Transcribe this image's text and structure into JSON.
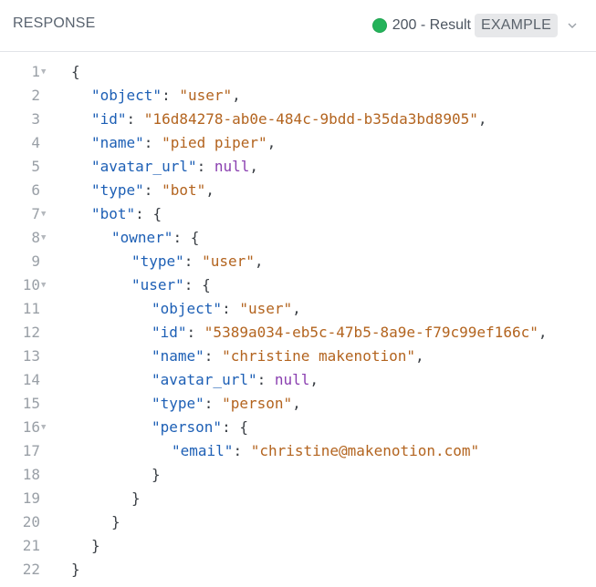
{
  "header": {
    "title": "RESPONSE",
    "status_text": "200 - Result",
    "example_label": "EXAMPLE",
    "status_color": "#24b35a"
  },
  "code": {
    "lines": [
      {
        "num": "1",
        "fold": true,
        "indent": 0,
        "parts": [
          {
            "t": "p",
            "v": "{"
          }
        ]
      },
      {
        "num": "2",
        "fold": false,
        "indent": 1,
        "parts": [
          {
            "t": "k",
            "v": "\"object\""
          },
          {
            "t": "p",
            "v": ": "
          },
          {
            "t": "s",
            "v": "\"user\""
          },
          {
            "t": "p",
            "v": ","
          }
        ]
      },
      {
        "num": "3",
        "fold": false,
        "indent": 1,
        "parts": [
          {
            "t": "k",
            "v": "\"id\""
          },
          {
            "t": "p",
            "v": ": "
          },
          {
            "t": "s",
            "v": "\"16d84278-ab0e-484c-9bdd-b35da3bd8905\""
          },
          {
            "t": "p",
            "v": ","
          }
        ]
      },
      {
        "num": "4",
        "fold": false,
        "indent": 1,
        "parts": [
          {
            "t": "k",
            "v": "\"name\""
          },
          {
            "t": "p",
            "v": ": "
          },
          {
            "t": "s",
            "v": "\"pied piper\""
          },
          {
            "t": "p",
            "v": ","
          }
        ]
      },
      {
        "num": "5",
        "fold": false,
        "indent": 1,
        "parts": [
          {
            "t": "k",
            "v": "\"avatar_url\""
          },
          {
            "t": "p",
            "v": ": "
          },
          {
            "t": "n",
            "v": "null"
          },
          {
            "t": "p",
            "v": ","
          }
        ]
      },
      {
        "num": "6",
        "fold": false,
        "indent": 1,
        "parts": [
          {
            "t": "k",
            "v": "\"type\""
          },
          {
            "t": "p",
            "v": ": "
          },
          {
            "t": "s",
            "v": "\"bot\""
          },
          {
            "t": "p",
            "v": ","
          }
        ]
      },
      {
        "num": "7",
        "fold": true,
        "indent": 1,
        "parts": [
          {
            "t": "k",
            "v": "\"bot\""
          },
          {
            "t": "p",
            "v": ": {"
          }
        ]
      },
      {
        "num": "8",
        "fold": true,
        "indent": 2,
        "parts": [
          {
            "t": "k",
            "v": "\"owner\""
          },
          {
            "t": "p",
            "v": ": {"
          }
        ]
      },
      {
        "num": "9",
        "fold": false,
        "indent": 3,
        "parts": [
          {
            "t": "k",
            "v": "\"type\""
          },
          {
            "t": "p",
            "v": ": "
          },
          {
            "t": "s",
            "v": "\"user\""
          },
          {
            "t": "p",
            "v": ","
          }
        ]
      },
      {
        "num": "10",
        "fold": true,
        "indent": 3,
        "parts": [
          {
            "t": "k",
            "v": "\"user\""
          },
          {
            "t": "p",
            "v": ": {"
          }
        ]
      },
      {
        "num": "11",
        "fold": false,
        "indent": 4,
        "parts": [
          {
            "t": "k",
            "v": "\"object\""
          },
          {
            "t": "p",
            "v": ": "
          },
          {
            "t": "s",
            "v": "\"user\""
          },
          {
            "t": "p",
            "v": ","
          }
        ]
      },
      {
        "num": "12",
        "fold": false,
        "indent": 4,
        "parts": [
          {
            "t": "k",
            "v": "\"id\""
          },
          {
            "t": "p",
            "v": ": "
          },
          {
            "t": "s",
            "v": "\"5389a034-eb5c-47b5-8a9e-f79c99ef166c\""
          },
          {
            "t": "p",
            "v": ","
          }
        ]
      },
      {
        "num": "13",
        "fold": false,
        "indent": 4,
        "parts": [
          {
            "t": "k",
            "v": "\"name\""
          },
          {
            "t": "p",
            "v": ": "
          },
          {
            "t": "s",
            "v": "\"christine makenotion\""
          },
          {
            "t": "p",
            "v": ","
          }
        ]
      },
      {
        "num": "14",
        "fold": false,
        "indent": 4,
        "parts": [
          {
            "t": "k",
            "v": "\"avatar_url\""
          },
          {
            "t": "p",
            "v": ": "
          },
          {
            "t": "n",
            "v": "null"
          },
          {
            "t": "p",
            "v": ","
          }
        ]
      },
      {
        "num": "15",
        "fold": false,
        "indent": 4,
        "parts": [
          {
            "t": "k",
            "v": "\"type\""
          },
          {
            "t": "p",
            "v": ": "
          },
          {
            "t": "s",
            "v": "\"person\""
          },
          {
            "t": "p",
            "v": ","
          }
        ]
      },
      {
        "num": "16",
        "fold": true,
        "indent": 4,
        "parts": [
          {
            "t": "k",
            "v": "\"person\""
          },
          {
            "t": "p",
            "v": ": {"
          }
        ]
      },
      {
        "num": "17",
        "fold": false,
        "indent": 5,
        "parts": [
          {
            "t": "k",
            "v": "\"email\""
          },
          {
            "t": "p",
            "v": ": "
          },
          {
            "t": "s",
            "v": "\"christine@makenotion.com\""
          }
        ]
      },
      {
        "num": "18",
        "fold": false,
        "indent": 4,
        "parts": [
          {
            "t": "p",
            "v": "}"
          }
        ]
      },
      {
        "num": "19",
        "fold": false,
        "indent": 3,
        "parts": [
          {
            "t": "p",
            "v": "}"
          }
        ]
      },
      {
        "num": "20",
        "fold": false,
        "indent": 2,
        "parts": [
          {
            "t": "p",
            "v": "}"
          }
        ]
      },
      {
        "num": "21",
        "fold": false,
        "indent": 1,
        "parts": [
          {
            "t": "p",
            "v": "}"
          }
        ]
      },
      {
        "num": "22",
        "fold": false,
        "indent": 0,
        "parts": [
          {
            "t": "p",
            "v": "}"
          }
        ]
      }
    ]
  }
}
